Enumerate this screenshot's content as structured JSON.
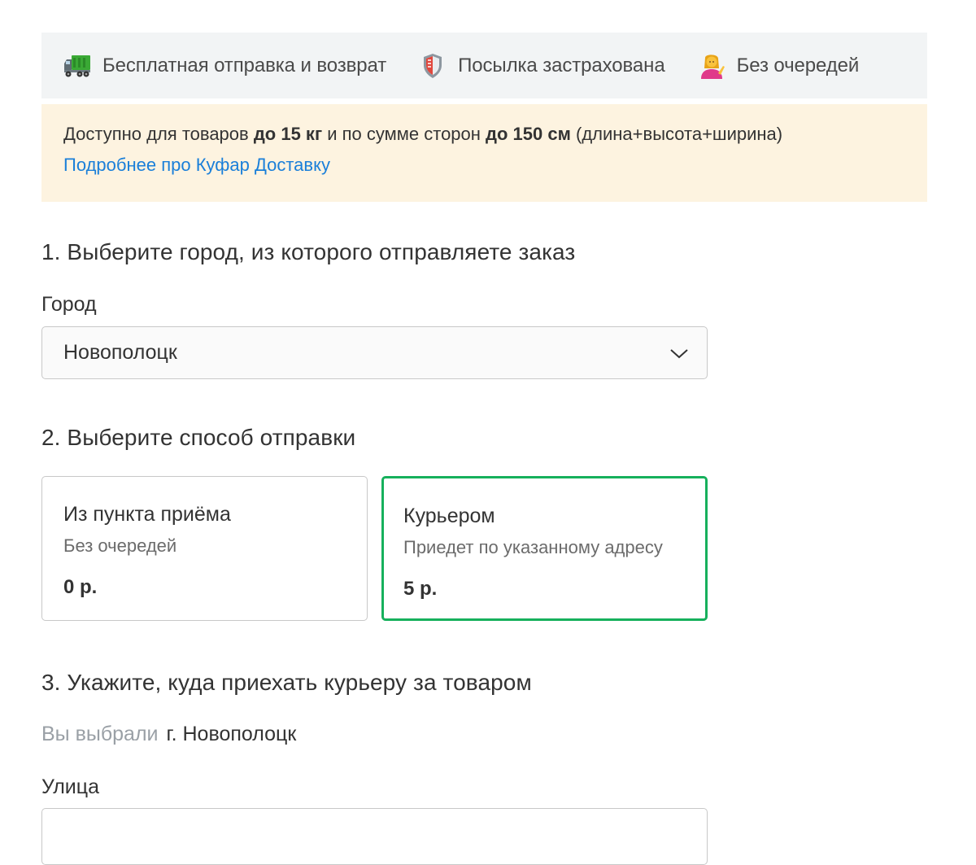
{
  "features": [
    {
      "icon": "delivery-truck-icon",
      "label": "Бесплатная отправка и возврат"
    },
    {
      "icon": "shield-icon",
      "label": "Посылка застрахована"
    },
    {
      "icon": "person-tipping-hand-icon",
      "label": "Без очередей"
    }
  ],
  "notice": {
    "text_1": "Доступно для товаров ",
    "bold_1": "до 15 кг",
    "text_2": " и по сумме сторон ",
    "bold_2": "до 150 см",
    "text_3": " (длина+высота+ширина)",
    "link": "Подробнее про Куфар Доставку"
  },
  "step1": {
    "title": "1. Выберите город, из которого отправляете заказ",
    "city_label": "Город",
    "city_value": "Новополоцк"
  },
  "step2": {
    "title": "2. Выберите способ отправки",
    "options": [
      {
        "title": "Из пункта приёма",
        "subtitle": "Без очередей",
        "price": "0 р.",
        "selected": false
      },
      {
        "title": "Курьером",
        "subtitle": "Приедет по указанному адресу",
        "price": "5 р.",
        "selected": true
      }
    ]
  },
  "step3": {
    "title": "3. Укажите, куда приехать курьеру за товаром",
    "chosen_label": "Вы выбрали",
    "chosen_value": "г. Новополоцк",
    "street_label": "Улица",
    "street_value": ""
  },
  "colors": {
    "accent_selected": "#16b05c",
    "link": "#1a7fd9",
    "notice_bg": "#fdf3e0",
    "features_bg": "#f2f4f5"
  }
}
